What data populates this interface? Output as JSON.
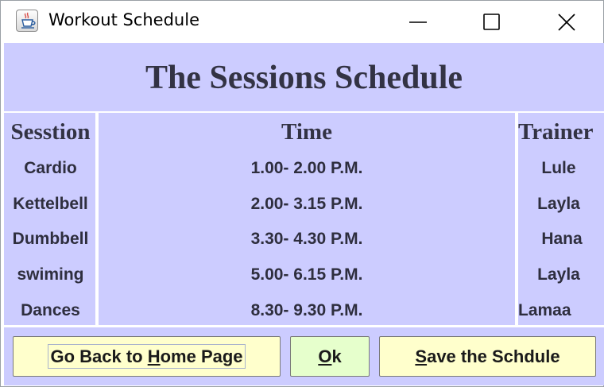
{
  "window": {
    "title": "Workout Schedule",
    "icon": "java-coffee-cup-icon",
    "controls": [
      "minimize-icon",
      "maximize-icon",
      "close-icon"
    ]
  },
  "heading": "The Sessions Schedule",
  "table": {
    "columns": [
      "Sesstion",
      "Time",
      "Trainer"
    ],
    "rows": [
      {
        "session": "Cardio",
        "time": "1.00- 2.00 P.M.",
        "trainer": "Lule"
      },
      {
        "session": "Kettelbell",
        "time": "2.00- 3.15 P.M.",
        "trainer": "Layla"
      },
      {
        "session": "Dumbbell",
        "time": "3.30- 4.30 P.M.",
        "trainer": "Hana"
      },
      {
        "session": "swiming",
        "time": "5.00- 6.15 P.M.",
        "trainer": "Layla"
      },
      {
        "session": "Dances",
        "time": "8.30- 9.30 P.M.",
        "trainer": "Lamaa"
      }
    ]
  },
  "buttons": {
    "home": {
      "prefix": "Go Back to ",
      "mnemonic": "H",
      "suffix": "ome Page"
    },
    "ok": {
      "prefix": "",
      "mnemonic": "O",
      "suffix": "k"
    },
    "save": {
      "prefix": "",
      "mnemonic": "S",
      "suffix": "ave the Schdule"
    }
  },
  "colors": {
    "content_background": "#ccccff",
    "yellow_button": "#ffffcc",
    "ok_button": "#e6ffcc",
    "heading_text": "#333344"
  }
}
